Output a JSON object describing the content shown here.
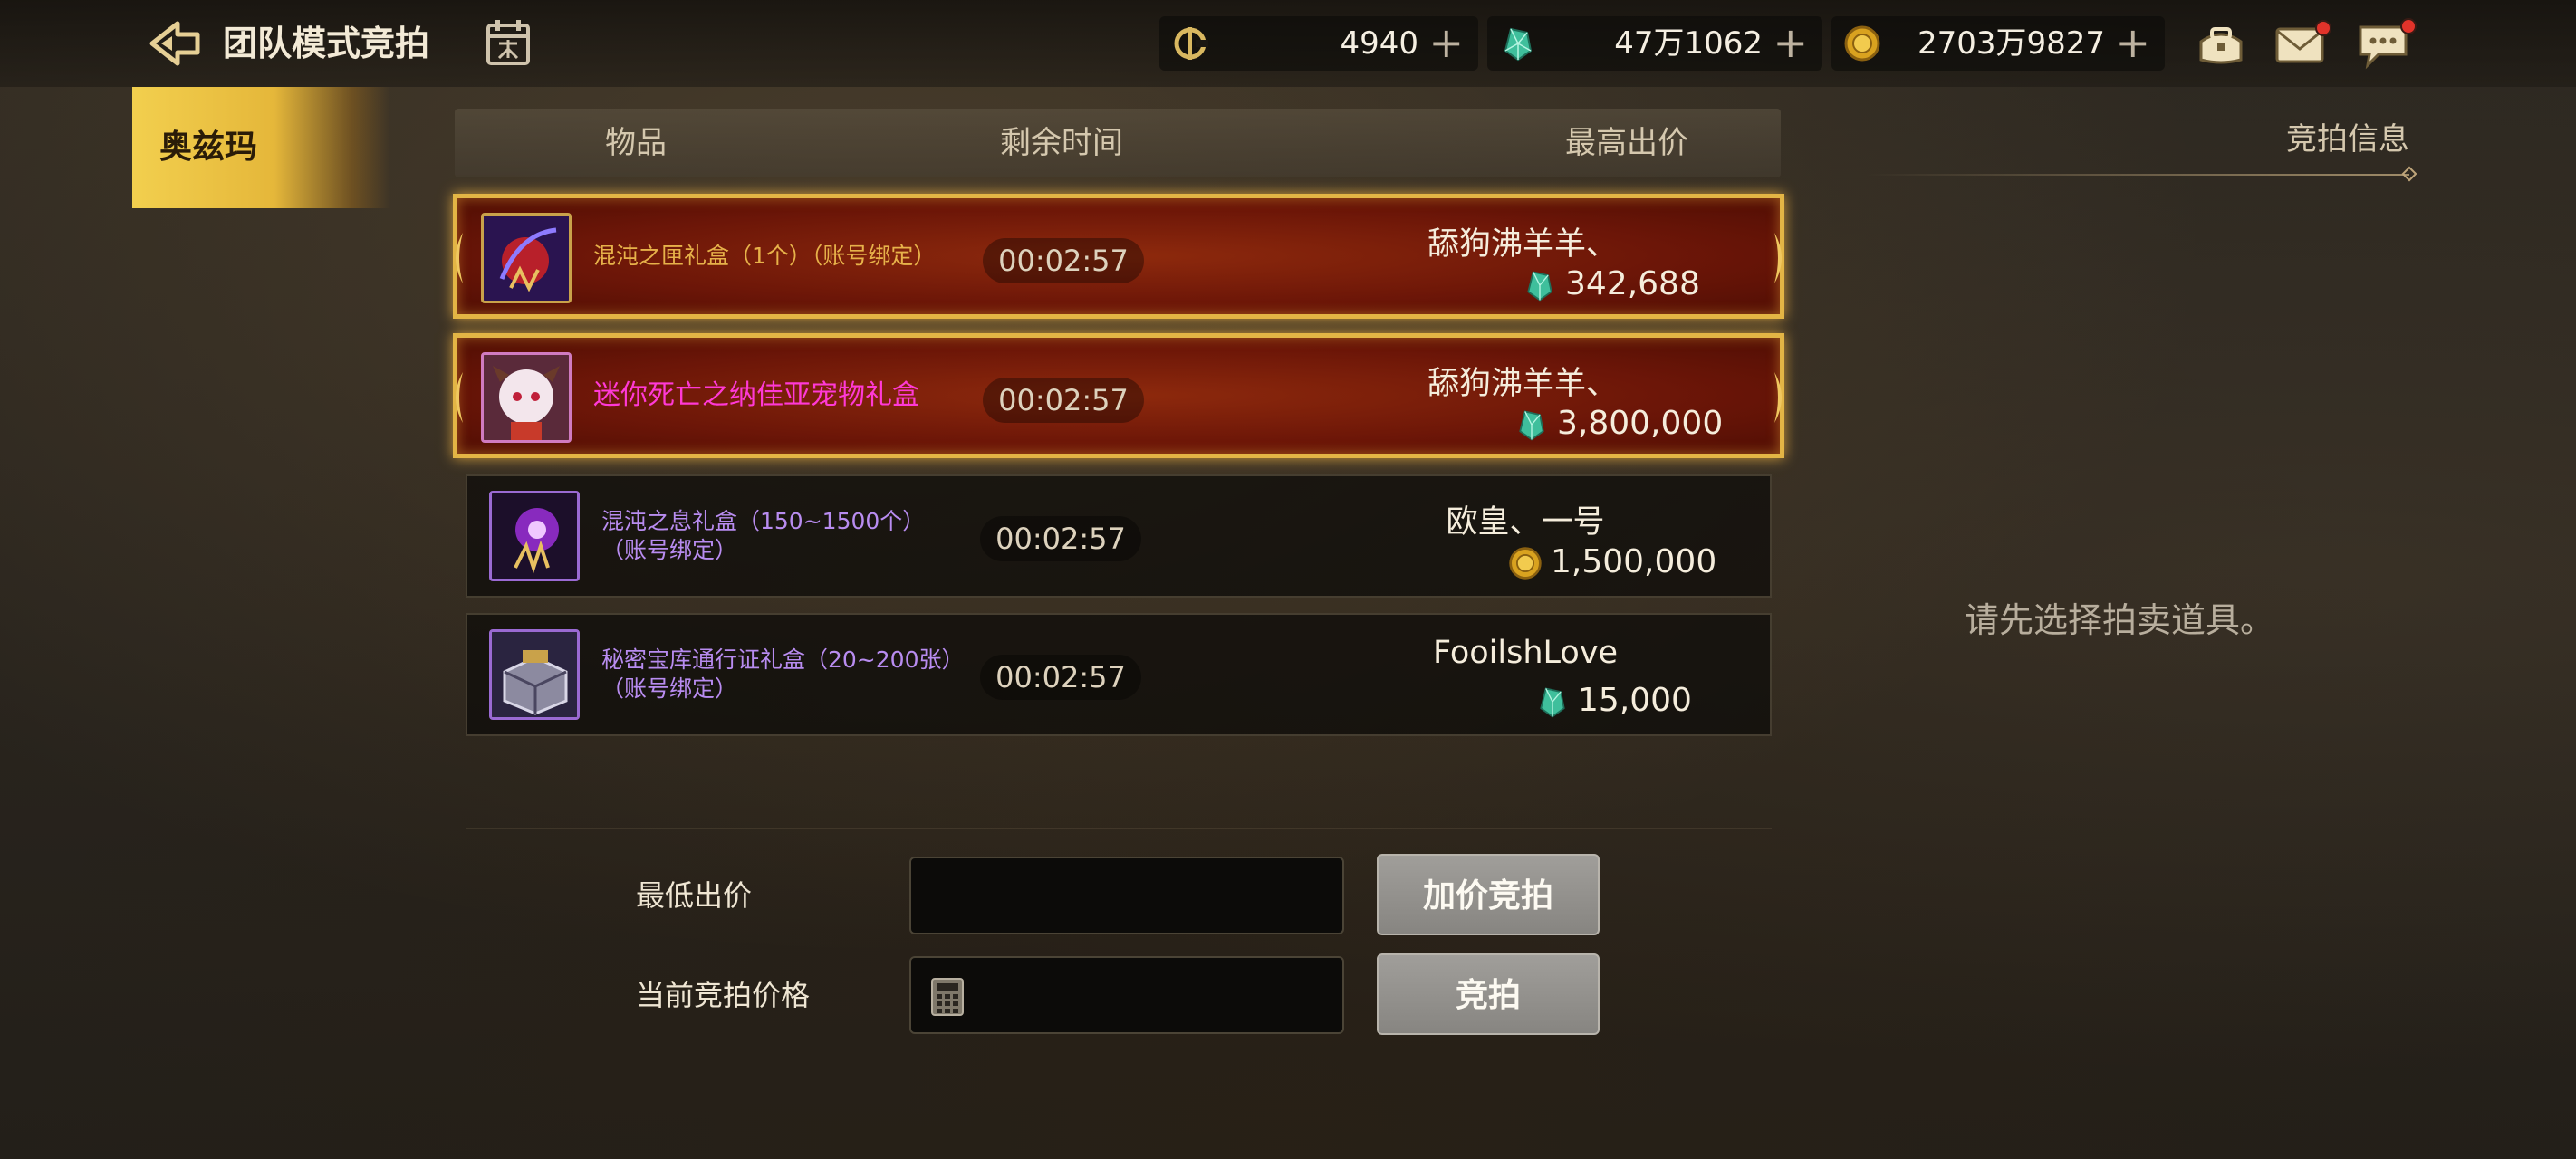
{
  "header": {
    "title": "团队模式竞拍",
    "currencies": [
      {
        "icon": "c-coin-icon",
        "value": "4940"
      },
      {
        "icon": "green-crystal-icon",
        "value": "47万1062"
      },
      {
        "icon": "gold-coin-icon",
        "value": "2703万9827"
      }
    ],
    "plus": "+"
  },
  "region": {
    "label": "奥兹玛"
  },
  "table": {
    "headers": {
      "item": "物品",
      "time": "剩余时间",
      "price": "最高出价"
    },
    "rows": [
      {
        "name": "混沌之匣礼盒（1个）（账号绑定）",
        "name_color": "#e7b24a",
        "time": "00:02:57",
        "bidder": "舔狗沸羊羊、",
        "amount": "342,688",
        "currency": "green-crystal-icon",
        "highlight": true
      },
      {
        "name": "迷你死亡之纳佳亚宠物礼盒",
        "name_color": "#ff39d6",
        "time": "00:02:57",
        "bidder": "舔狗沸羊羊、",
        "amount": "3,800,000",
        "currency": "green-crystal-icon",
        "highlight": true
      },
      {
        "name": "混沌之息礼盒（150~1500个）（账号绑定）",
        "name_color": "#b88cf0",
        "time": "00:02:57",
        "bidder": "欧皇、一号",
        "amount": "1,500,000",
        "currency": "gold-coin-icon",
        "highlight": false
      },
      {
        "name": "秘密宝库通行证礼盒（20~200张）（账号绑定）",
        "name_color": "#b88cf0",
        "time": "00:02:57",
        "bidder": "FooilshLove",
        "amount": "15,000",
        "currency": "green-crystal-icon",
        "highlight": false
      }
    ]
  },
  "form": {
    "min_bid_label": "最低出价",
    "current_price_label": "当前竞拍价格",
    "raise_button": "加价竞拍",
    "bid_button": "竞拍"
  },
  "info_panel": {
    "title": "竞拍信息",
    "hint": "请先选择拍卖道具。"
  },
  "colors": {
    "gold_accent": "#e3b545",
    "highlight_row": "#8a1a08",
    "panel_text": "#d5c8ae"
  }
}
